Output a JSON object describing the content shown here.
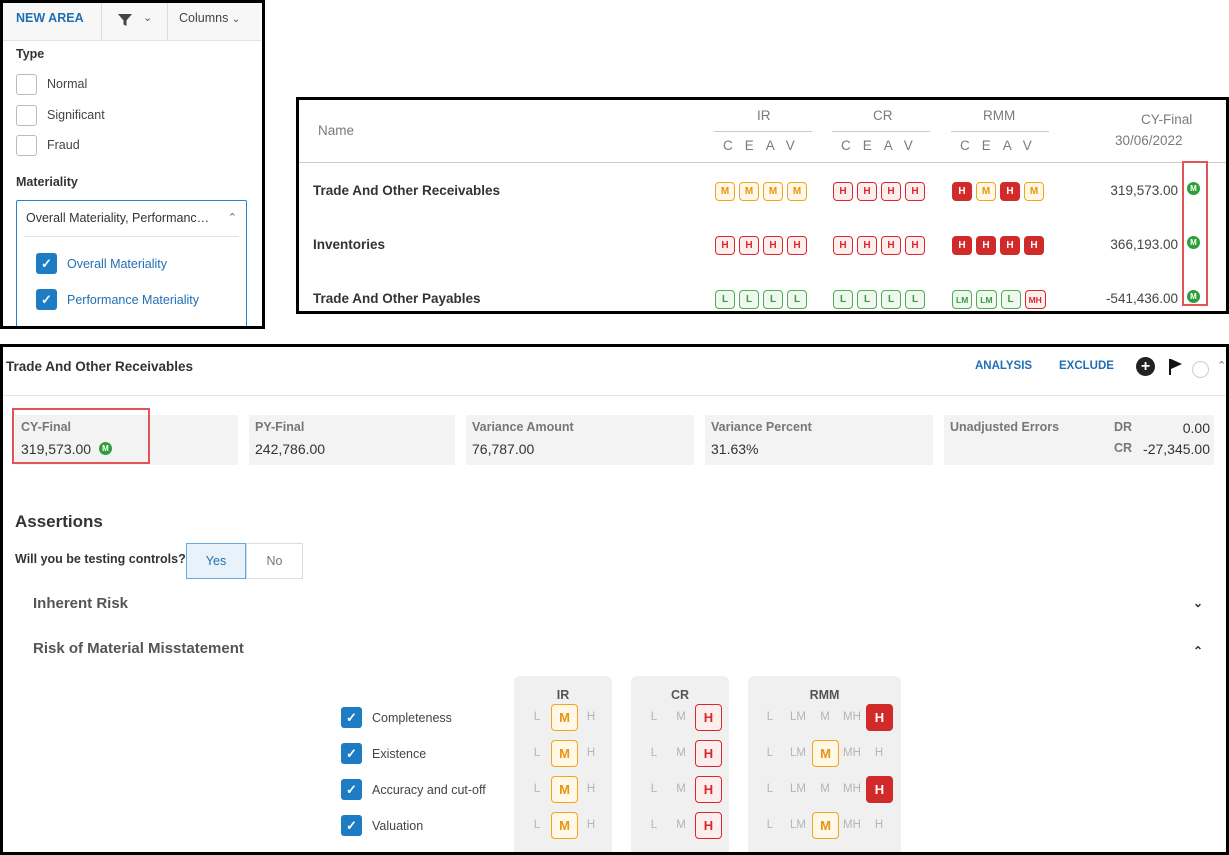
{
  "filter": {
    "new_area": "NEW AREA",
    "columns": "Columns",
    "type_label": "Type",
    "types": [
      "Normal",
      "Significant",
      "Fraud"
    ],
    "materiality_label": "Materiality",
    "materiality_selected": "Overall Materiality, Performance Materiality",
    "materiality_options": [
      "Overall Materiality",
      "Performance Materiality"
    ]
  },
  "table": {
    "name_header": "Name",
    "groups": [
      "IR",
      "CR",
      "RMM"
    ],
    "sub_headers": "CEAV",
    "final_header": "CY-Final",
    "final_date": "30/06/2022",
    "rows": [
      {
        "name": "Trade And Other Receivables",
        "value": "319,573.00",
        "ir": [
          "M",
          "M",
          "M",
          "M"
        ],
        "cr": [
          "H",
          "H",
          "H",
          "H"
        ],
        "rmm": [
          "H",
          "M",
          "H",
          "M"
        ],
        "rmm_filled": [
          true,
          false,
          true,
          false
        ],
        "materiality_icon": "M"
      },
      {
        "name": "Inventories",
        "value": "366,193.00",
        "ir": [
          "H",
          "H",
          "H",
          "H"
        ],
        "cr": [
          "H",
          "H",
          "H",
          "H"
        ],
        "rmm": [
          "H",
          "H",
          "H",
          "H"
        ],
        "rmm_filled": [
          true,
          true,
          true,
          true
        ],
        "materiality_icon": "M"
      },
      {
        "name": "Trade And Other Payables",
        "value": "-541,436.00",
        "ir": [
          "L",
          "L",
          "L",
          "L"
        ],
        "cr": [
          "L",
          "L",
          "L",
          "L"
        ],
        "rmm": [
          "LM",
          "LM",
          "L",
          "MH"
        ],
        "rmm_filled": [
          false,
          false,
          false,
          false
        ],
        "materiality_icon": "M"
      }
    ]
  },
  "detail": {
    "title": "Trade And Other Receivables",
    "analysis": "ANALYSIS",
    "exclude": "EXCLUDE",
    "cards": {
      "cy_label": "CY-Final",
      "cy_value": "319,573.00",
      "py_label": "PY-Final",
      "py_value": "242,786.00",
      "var_amt_label": "Variance Amount",
      "var_amt_value": "76,787.00",
      "var_pct_label": "Variance Percent",
      "var_pct_value": "31.63%",
      "unadj_label": "Unadjusted Errors",
      "dr_label": "DR",
      "dr_value": "0.00",
      "cr_label": "CR",
      "cr_value": "-27,345.00"
    },
    "assertions_title": "Assertions",
    "testing_question": "Will you be testing controls?",
    "yes": "Yes",
    "no": "No",
    "inherent_risk": "Inherent Risk",
    "rmm_title": "Risk of Material Misstatement",
    "assessment_headers": [
      "IR",
      "CR",
      "RMM"
    ],
    "ir_levels": [
      "L",
      "M",
      "H"
    ],
    "cr_levels": [
      "L",
      "M",
      "H"
    ],
    "rmm_levels": [
      "L",
      "LM",
      "M",
      "MH",
      "H"
    ],
    "assertions": [
      {
        "name": "Completeness",
        "ir": "M",
        "cr": "H",
        "rmm": "H"
      },
      {
        "name": "Existence",
        "ir": "M",
        "cr": "H",
        "rmm": "M"
      },
      {
        "name": "Accuracy and cut-off",
        "ir": "M",
        "cr": "H",
        "rmm": "H"
      },
      {
        "name": "Valuation",
        "ir": "M",
        "cr": "H",
        "rmm": "M"
      }
    ]
  },
  "colors": {
    "accent": "#1f6fb4",
    "high": "#d12a2a",
    "medium": "#f0a51c",
    "low": "#4caf50"
  }
}
